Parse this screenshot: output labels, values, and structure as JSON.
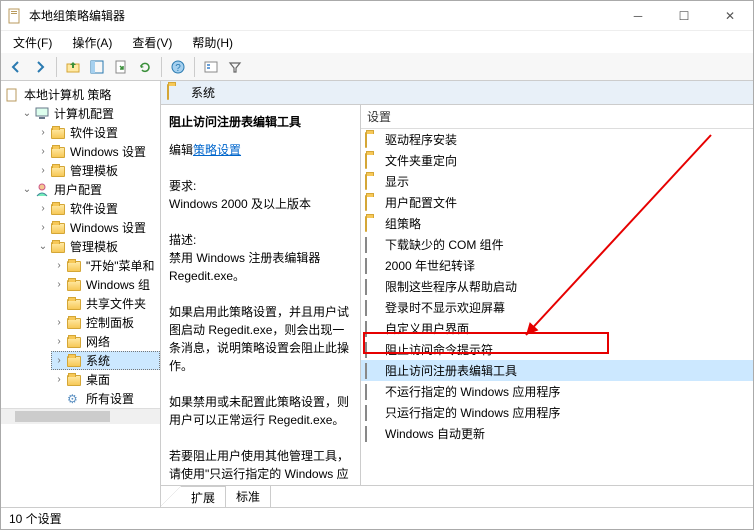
{
  "window": {
    "title": "本地组策略编辑器"
  },
  "menu": {
    "file": "文件(F)",
    "action": "操作(A)",
    "view": "查看(V)",
    "help": "帮助(H)"
  },
  "tree": {
    "root": "本地计算机 策略",
    "computer": "计算机配置",
    "softSettings": "软件设置",
    "winSettings": "Windows 设置",
    "adminTemplates": "管理模板",
    "user": "用户配置",
    "start": "\"开始\"菜单和",
    "components": "Windows 组",
    "shared": "共享文件夹",
    "controlPanel": "控制面板",
    "network": "网络",
    "system": "系统",
    "desktop": "桌面",
    "allSettings": "所有设置"
  },
  "path": {
    "label": "系统"
  },
  "desc": {
    "title": "阻止访问注册表编辑工具",
    "editLabel": "编辑",
    "editLink": "策略设置",
    "reqLabel": "要求:",
    "reqValue": "Windows 2000 及以上版本",
    "descLabel": "描述:",
    "p1": "禁用 Windows 注册表编辑器 Regedit.exe。",
    "p2": "如果启用此策略设置，并且用户试图启动 Regedit.exe，则会出现一条消息，说明策略设置会阻止此操作。",
    "p3": "如果禁用或未配置此策略设置，则用户可以正常运行 Regedit.exe。",
    "p4": "若要阻止用户使用其他管理工具，请使用\"只运行指定的 Windows 应用程序\"策略设置。"
  },
  "list": {
    "header": "设置",
    "items": [
      {
        "type": "folder",
        "label": "驱动程序安装"
      },
      {
        "type": "folder",
        "label": "文件夹重定向"
      },
      {
        "type": "folder",
        "label": "显示"
      },
      {
        "type": "folder",
        "label": "用户配置文件"
      },
      {
        "type": "folder",
        "label": "组策略"
      },
      {
        "type": "policy",
        "label": "下载缺少的 COM 组件"
      },
      {
        "type": "policy",
        "label": "2000 年世纪转译"
      },
      {
        "type": "policy",
        "label": "限制这些程序从帮助启动"
      },
      {
        "type": "policy",
        "label": "登录时不显示欢迎屏幕"
      },
      {
        "type": "policy",
        "label": "自定义用户界面"
      },
      {
        "type": "policy",
        "label": "阻止访问命令提示符"
      },
      {
        "type": "policy",
        "label": "阻止访问注册表编辑工具",
        "highlight": true
      },
      {
        "type": "policy",
        "label": "不运行指定的 Windows 应用程序"
      },
      {
        "type": "policy",
        "label": "只运行指定的 Windows 应用程序"
      },
      {
        "type": "policy",
        "label": "Windows 自动更新"
      }
    ]
  },
  "tabs": {
    "extended": "扩展",
    "standard": "标准"
  },
  "status": {
    "text": "10 个设置"
  }
}
